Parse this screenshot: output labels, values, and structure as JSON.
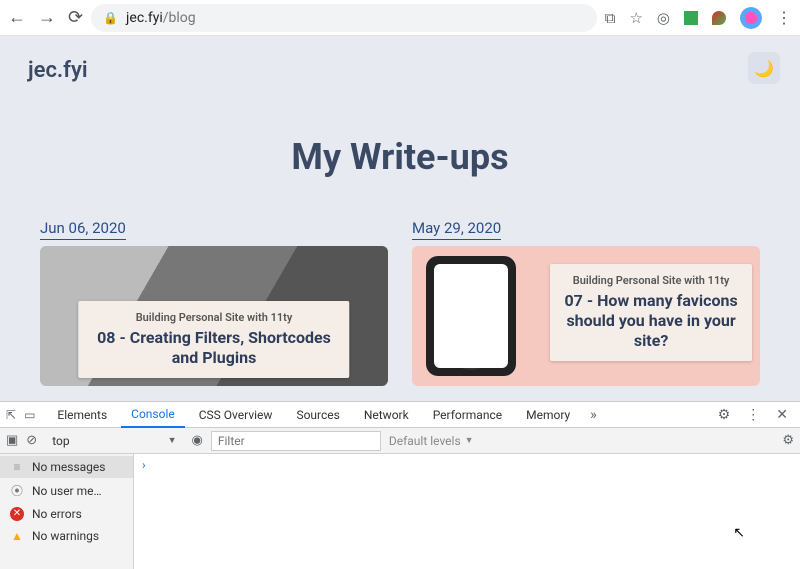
{
  "browser": {
    "url_domain": "jec.fyi",
    "url_path": "/blog"
  },
  "site": {
    "brand": "jec.fyi",
    "title": "My Write-ups"
  },
  "posts": [
    {
      "date": "Jun 06, 2020",
      "series": "Building Personal Site with 11ty",
      "title": "08 - Creating Filters, Shortcodes and Plugins"
    },
    {
      "date": "May 29, 2020",
      "series": "Building Personal Site with 11ty",
      "title": "07 - How many favicons should you have in your site?"
    }
  ],
  "devtools": {
    "tabs": [
      "Elements",
      "Console",
      "CSS Overview",
      "Sources",
      "Network",
      "Performance",
      "Memory"
    ],
    "active_tab": "Console",
    "context": "top",
    "filter_placeholder": "Filter",
    "levels_label": "Default levels",
    "sidebar": [
      {
        "icon": "msg",
        "label": "No messages"
      },
      {
        "icon": "user",
        "label": "No user me…"
      },
      {
        "icon": "err",
        "label": "No errors"
      },
      {
        "icon": "warn",
        "label": "No warnings"
      }
    ],
    "prompt": "›"
  }
}
